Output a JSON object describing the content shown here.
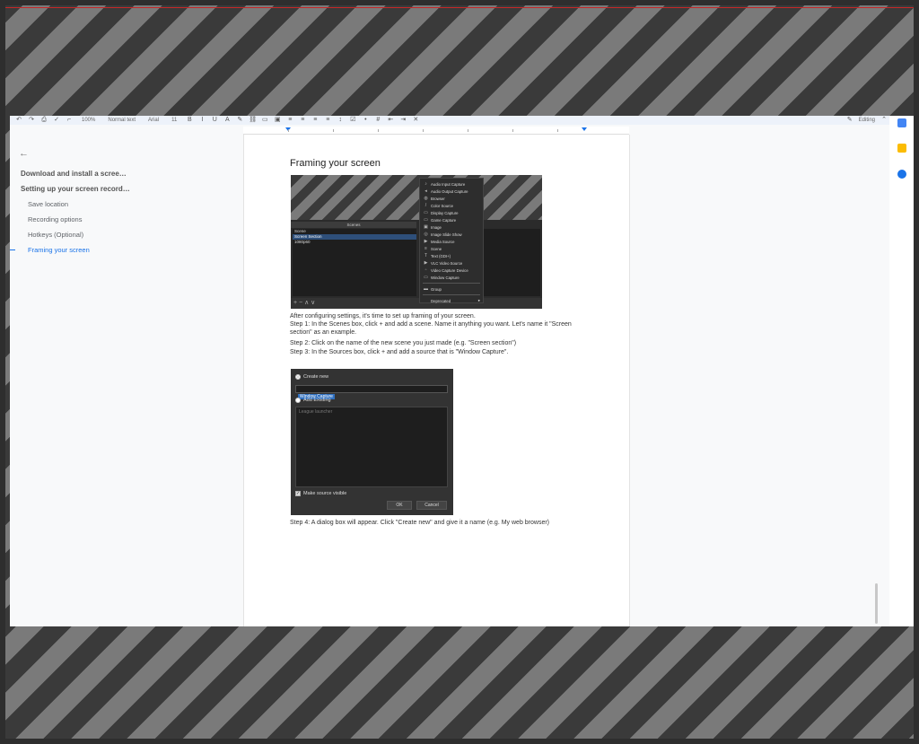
{
  "toolbar": {
    "zoom": "100%",
    "style": "Normal text",
    "font": "Arial",
    "size": "11",
    "mode": "Editing"
  },
  "outline": {
    "items": [
      {
        "label": "Download and install a scree…",
        "level": 1
      },
      {
        "label": "Setting up your screen record…",
        "level": 1
      },
      {
        "label": "Save location",
        "level": 2
      },
      {
        "label": "Recording options",
        "level": 2
      },
      {
        "label": "Hotkeys (Optional)",
        "level": 2
      },
      {
        "label": "Framing your screen",
        "level": 2,
        "active": true
      }
    ]
  },
  "doc": {
    "heading": "Framing your screen",
    "para1": "After configuring settings, it's time to set up framing of your screen.",
    "step1": "Step 1: In the Scenes box, click + and add a scene. Name it anything you want. Let's name it \"Screen section\" as an example.",
    "step2": "Step 2: Click on the name of the new scene you just made (e.g. \"Screen section\")",
    "step3": "Step 3: In the Sources box, click + and add a source that is \"Window Capture\".",
    "step4": "Step 4: A dialog box will appear. Click \"Create new\" and give it a name (e.g. My web browser)"
  },
  "obs": {
    "scenes_header": "Scenes",
    "scenes": [
      "Scene",
      "Screen Section",
      "1080p60"
    ],
    "menu": [
      {
        "label": "Audio Input Capture",
        "icon": "mic-icon"
      },
      {
        "label": "Audio Output Capture",
        "icon": "speaker-icon"
      },
      {
        "label": "Browser",
        "icon": "globe-icon"
      },
      {
        "label": "Color Source",
        "icon": "brush-icon"
      },
      {
        "label": "Display Capture",
        "icon": "monitor-icon"
      },
      {
        "label": "Game Capture",
        "icon": "gamepad-icon"
      },
      {
        "label": "Image",
        "icon": "image-icon"
      },
      {
        "label": "Image Slide Show",
        "icon": "slideshow-icon"
      },
      {
        "label": "Media Source",
        "icon": "play-icon"
      },
      {
        "label": "Scene",
        "icon": "list-icon"
      },
      {
        "label": "Text (GDI+)",
        "icon": "text-icon"
      },
      {
        "label": "VLC Video Source",
        "icon": "play-icon"
      },
      {
        "label": "Video Capture Device",
        "icon": "camera-icon"
      },
      {
        "label": "Window Capture",
        "icon": "window-icon"
      },
      {
        "label": "Group",
        "icon": "folder-icon"
      },
      {
        "label": "Deprecated",
        "icon": "chevron-right-icon"
      }
    ],
    "controls": "+ −  ∧ ∨"
  },
  "dialog": {
    "create_new": "Create new",
    "name_value": "Window Capture",
    "add_existing": "Add Existing",
    "existing_item": "League launcher",
    "make_visible": "Make source visible",
    "ok": "OK",
    "cancel": "Cancel"
  },
  "colors": {
    "accent": "#1a73e8",
    "page_bg": "#ffffff",
    "obs_bg": "#2b2b2b"
  }
}
